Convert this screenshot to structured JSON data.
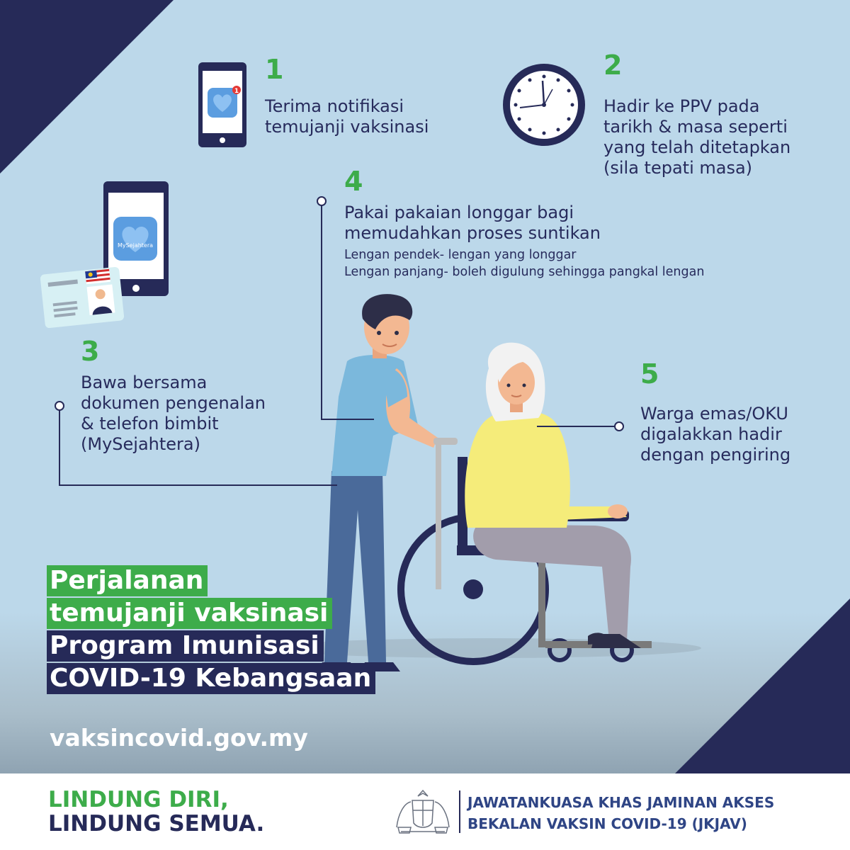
{
  "steps": [
    {
      "number": "1",
      "lines": [
        "Terima notifikasi",
        "temujanji vaksinasi"
      ]
    },
    {
      "number": "2",
      "lines": [
        "Hadir ke PPV pada",
        "tarikh & masa seperti",
        "yang telah ditetapkan",
        "(sila tepati masa)"
      ]
    },
    {
      "number": "3",
      "lines": [
        "Bawa bersama",
        "dokumen pengenalan",
        "& telefon bimbit",
        "(MySejahtera)"
      ]
    },
    {
      "number": "4",
      "lines": [
        "Pakai pakaian longgar bagi",
        "memudahkan proses suntikan"
      ],
      "details": [
        "Lengan pendek- lengan yang longgar",
        "Lengan panjang- boleh digulung sehingga pangkal lengan"
      ]
    },
    {
      "number": "5",
      "lines": [
        "Warga emas/OKU",
        "digalakkan hadir",
        "dengan pengiring"
      ]
    }
  ],
  "phone_app": {
    "label": "MySejahtera",
    "notification_badge": "1"
  },
  "title": {
    "green_lines": [
      "Perjalanan",
      "temujanji vaksinasi"
    ],
    "navy_lines": [
      "Program Imunisasi",
      "COVID-19 Kebangsaan"
    ]
  },
  "website": "vaksincovid.gov.my",
  "footer": {
    "slogan": [
      "LINDUNG DIRI,",
      "LINDUNG SEMUA."
    ],
    "committee": [
      "JAWATANKUASA KHAS JAMINAN AKSES",
      "BEKALAN VAKSIN COVID-19 (JKJAV)"
    ]
  },
  "colors": {
    "background": "#bcd8ea",
    "navy": "#262a58",
    "green": "#3dac4a",
    "text": "#272b5c",
    "committee_blue": "#2f4585"
  }
}
